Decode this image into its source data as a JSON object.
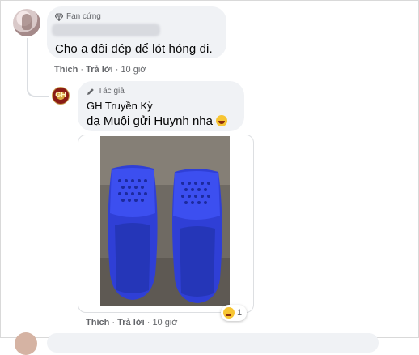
{
  "comment1": {
    "badge": "Fan cứng",
    "text": "Cho a đôi dép để lót hóng đi.",
    "actions": {
      "like": "Thích",
      "reply": "Trả lời",
      "time": "10 giờ"
    }
  },
  "reply": {
    "badge": "Tác giả",
    "author": "GH Truyền Kỳ",
    "avatar_text": "GH",
    "text": "dạ Muội gửi Huynh nha",
    "reaction_count": "1",
    "actions": {
      "like": "Thích",
      "reply": "Trả lời",
      "time": "10 giờ"
    }
  },
  "colors": {
    "bubble": "#f0f2f5",
    "meta": "#65676b",
    "sandal": "#2f3fd6"
  }
}
